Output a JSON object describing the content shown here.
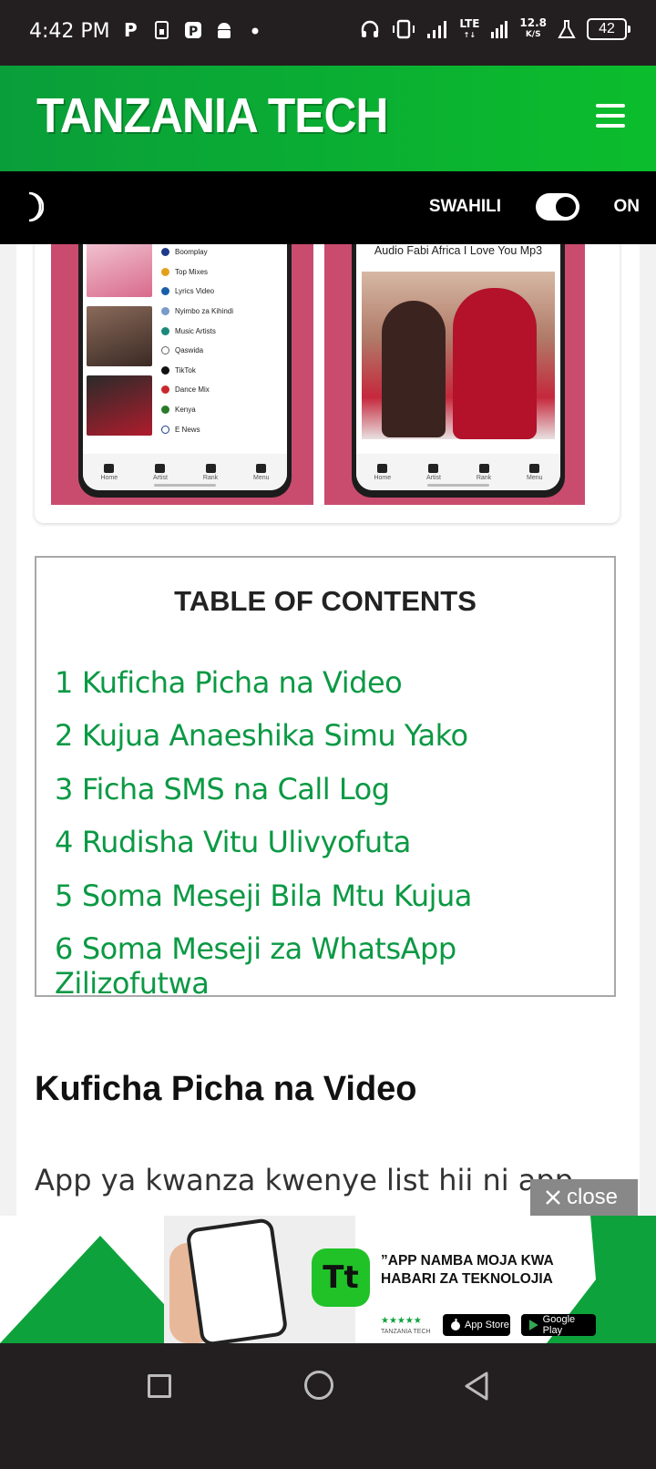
{
  "status_bar": {
    "time": "4:42 PM",
    "network_type": "LTE",
    "speed_value": "12.8",
    "speed_unit": "K/S",
    "battery": "42"
  },
  "header": {
    "logo": "TANZANIA TECH"
  },
  "mode_bar": {
    "language": "SWAHILI",
    "toggle_state": "ON"
  },
  "image_card": {
    "left_menu": [
      "Boomplay",
      "Top Mixes",
      "Lyrics Video",
      "Nyimbo za Kihindi",
      "Music Artists",
      "Qaswida",
      "TikTok",
      "Dance Mix",
      "Kenya",
      "E News"
    ],
    "nav_tabs": [
      "Home",
      "Artist",
      "Rank",
      "Menu"
    ],
    "right_title": "Audio Fabi Africa I Love You Mp3"
  },
  "toc": {
    "title": "TABLE OF CONTENTS",
    "items": [
      {
        "num": "1",
        "label": "Kuficha Picha na Video"
      },
      {
        "num": "2",
        "label": "Kujua Anaeshika Simu Yako"
      },
      {
        "num": "3",
        "label": "Ficha SMS na Call Log"
      },
      {
        "num": "4",
        "label": "Rudisha Vitu Ulivyofuta"
      },
      {
        "num": "5",
        "label": "Soma Meseji Bila Mtu Kujua"
      },
      {
        "num": "6",
        "label": "Soma Meseji za WhatsApp Zilizofutwa"
      }
    ]
  },
  "article": {
    "heading": "Kuficha Picha na Video",
    "paragraph": "App ya kwanza kwenye list hii ni app"
  },
  "ad": {
    "close_label": "close",
    "logo_text": "Tt",
    "tagline_line1": "”APP NAMBA MOJA KWA",
    "tagline_line2": "HABARI ZA TEKNOLOJIA",
    "brand": "TANZANIA TECH",
    "app_store": "App Store",
    "google_play": "Google Play"
  },
  "colors": {
    "header_green": "#0bbd2c",
    "link_green": "#0b9944",
    "dark": "#231f20"
  }
}
